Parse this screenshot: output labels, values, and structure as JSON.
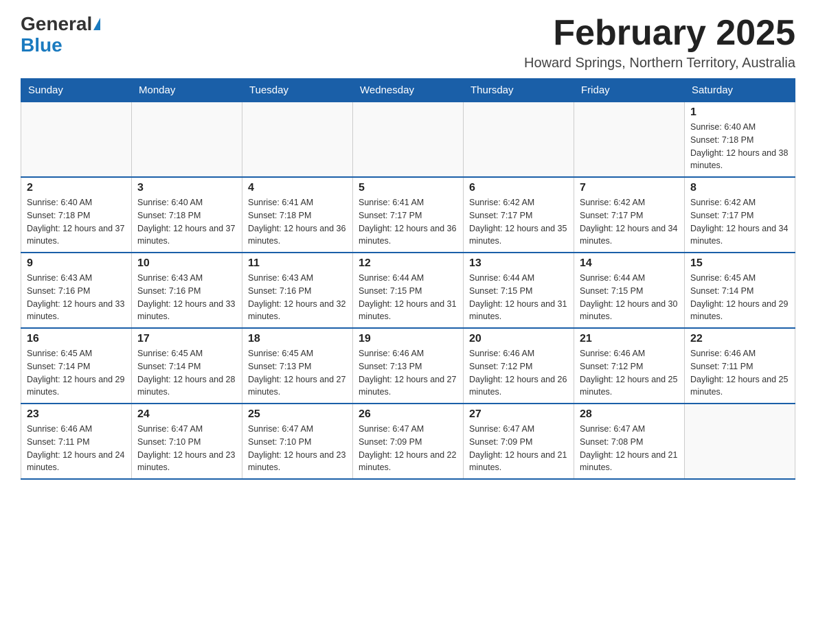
{
  "logo": {
    "general": "General",
    "blue": "Blue"
  },
  "header": {
    "month_year": "February 2025",
    "location": "Howard Springs, Northern Territory, Australia"
  },
  "days_of_week": [
    "Sunday",
    "Monday",
    "Tuesday",
    "Wednesday",
    "Thursday",
    "Friday",
    "Saturday"
  ],
  "weeks": [
    [
      {
        "day": "",
        "info": ""
      },
      {
        "day": "",
        "info": ""
      },
      {
        "day": "",
        "info": ""
      },
      {
        "day": "",
        "info": ""
      },
      {
        "day": "",
        "info": ""
      },
      {
        "day": "",
        "info": ""
      },
      {
        "day": "1",
        "info": "Sunrise: 6:40 AM\nSunset: 7:18 PM\nDaylight: 12 hours and 38 minutes."
      }
    ],
    [
      {
        "day": "2",
        "info": "Sunrise: 6:40 AM\nSunset: 7:18 PM\nDaylight: 12 hours and 37 minutes."
      },
      {
        "day": "3",
        "info": "Sunrise: 6:40 AM\nSunset: 7:18 PM\nDaylight: 12 hours and 37 minutes."
      },
      {
        "day": "4",
        "info": "Sunrise: 6:41 AM\nSunset: 7:18 PM\nDaylight: 12 hours and 36 minutes."
      },
      {
        "day": "5",
        "info": "Sunrise: 6:41 AM\nSunset: 7:17 PM\nDaylight: 12 hours and 36 minutes."
      },
      {
        "day": "6",
        "info": "Sunrise: 6:42 AM\nSunset: 7:17 PM\nDaylight: 12 hours and 35 minutes."
      },
      {
        "day": "7",
        "info": "Sunrise: 6:42 AM\nSunset: 7:17 PM\nDaylight: 12 hours and 34 minutes."
      },
      {
        "day": "8",
        "info": "Sunrise: 6:42 AM\nSunset: 7:17 PM\nDaylight: 12 hours and 34 minutes."
      }
    ],
    [
      {
        "day": "9",
        "info": "Sunrise: 6:43 AM\nSunset: 7:16 PM\nDaylight: 12 hours and 33 minutes."
      },
      {
        "day": "10",
        "info": "Sunrise: 6:43 AM\nSunset: 7:16 PM\nDaylight: 12 hours and 33 minutes."
      },
      {
        "day": "11",
        "info": "Sunrise: 6:43 AM\nSunset: 7:16 PM\nDaylight: 12 hours and 32 minutes."
      },
      {
        "day": "12",
        "info": "Sunrise: 6:44 AM\nSunset: 7:15 PM\nDaylight: 12 hours and 31 minutes."
      },
      {
        "day": "13",
        "info": "Sunrise: 6:44 AM\nSunset: 7:15 PM\nDaylight: 12 hours and 31 minutes."
      },
      {
        "day": "14",
        "info": "Sunrise: 6:44 AM\nSunset: 7:15 PM\nDaylight: 12 hours and 30 minutes."
      },
      {
        "day": "15",
        "info": "Sunrise: 6:45 AM\nSunset: 7:14 PM\nDaylight: 12 hours and 29 minutes."
      }
    ],
    [
      {
        "day": "16",
        "info": "Sunrise: 6:45 AM\nSunset: 7:14 PM\nDaylight: 12 hours and 29 minutes."
      },
      {
        "day": "17",
        "info": "Sunrise: 6:45 AM\nSunset: 7:14 PM\nDaylight: 12 hours and 28 minutes."
      },
      {
        "day": "18",
        "info": "Sunrise: 6:45 AM\nSunset: 7:13 PM\nDaylight: 12 hours and 27 minutes."
      },
      {
        "day": "19",
        "info": "Sunrise: 6:46 AM\nSunset: 7:13 PM\nDaylight: 12 hours and 27 minutes."
      },
      {
        "day": "20",
        "info": "Sunrise: 6:46 AM\nSunset: 7:12 PM\nDaylight: 12 hours and 26 minutes."
      },
      {
        "day": "21",
        "info": "Sunrise: 6:46 AM\nSunset: 7:12 PM\nDaylight: 12 hours and 25 minutes."
      },
      {
        "day": "22",
        "info": "Sunrise: 6:46 AM\nSunset: 7:11 PM\nDaylight: 12 hours and 25 minutes."
      }
    ],
    [
      {
        "day": "23",
        "info": "Sunrise: 6:46 AM\nSunset: 7:11 PM\nDaylight: 12 hours and 24 minutes."
      },
      {
        "day": "24",
        "info": "Sunrise: 6:47 AM\nSunset: 7:10 PM\nDaylight: 12 hours and 23 minutes."
      },
      {
        "day": "25",
        "info": "Sunrise: 6:47 AM\nSunset: 7:10 PM\nDaylight: 12 hours and 23 minutes."
      },
      {
        "day": "26",
        "info": "Sunrise: 6:47 AM\nSunset: 7:09 PM\nDaylight: 12 hours and 22 minutes."
      },
      {
        "day": "27",
        "info": "Sunrise: 6:47 AM\nSunset: 7:09 PM\nDaylight: 12 hours and 21 minutes."
      },
      {
        "day": "28",
        "info": "Sunrise: 6:47 AM\nSunset: 7:08 PM\nDaylight: 12 hours and 21 minutes."
      },
      {
        "day": "",
        "info": ""
      }
    ]
  ]
}
